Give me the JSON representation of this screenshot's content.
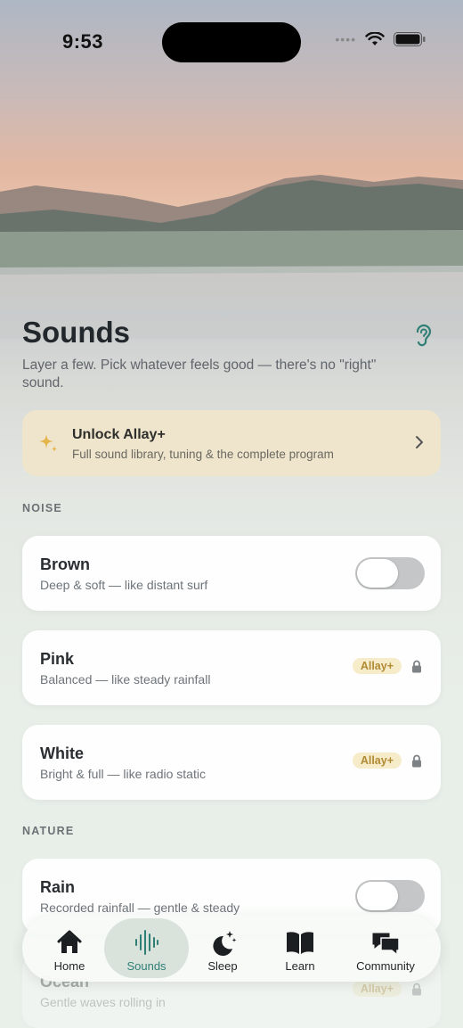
{
  "status_bar": {
    "time": "9:53"
  },
  "header": {
    "title": "Sounds",
    "subtitle": "Layer a few. Pick whatever feels good — there's no \"right\" sound."
  },
  "unlock": {
    "title": "Unlock Allay+",
    "subtitle": "Full sound library, tuning & the complete program"
  },
  "sections": {
    "noise": "NOISE",
    "nature": "NATURE"
  },
  "noise_items": [
    {
      "name": "Brown",
      "description": "Deep & soft — like distant surf",
      "toggle_on": false
    },
    {
      "name": "Pink",
      "description": "Balanced — like steady rainfall",
      "badge": "Allay+"
    },
    {
      "name": "White",
      "description": "Bright & full — like radio static",
      "badge": "Allay+"
    }
  ],
  "nature_items": [
    {
      "name": "Rain",
      "description": "Recorded rainfall — gentle & steady",
      "toggle_on": false
    },
    {
      "name": "Ocean",
      "description": "Gentle waves rolling in",
      "badge": "Allay+"
    }
  ],
  "tabs": [
    {
      "label": "Home",
      "icon": "house-icon"
    },
    {
      "label": "Sounds",
      "icon": "waveform-icon",
      "active": true
    },
    {
      "label": "Sleep",
      "icon": "moon-stars-icon"
    },
    {
      "label": "Learn",
      "icon": "book-icon"
    },
    {
      "label": "Community",
      "icon": "chat-bubbles-icon"
    }
  ],
  "colors": {
    "accent": "#2f7f76",
    "premium_badge_bg": "#f7ecc9",
    "premium_badge_text": "#b08a35",
    "unlock_card_bg": "#efe5cd"
  }
}
